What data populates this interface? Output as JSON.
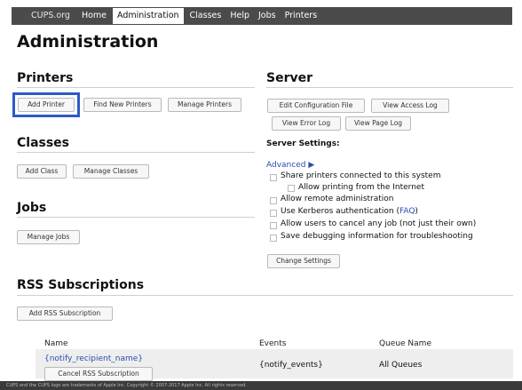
{
  "nav": {
    "items": [
      "CUPS.org",
      "Home",
      "Administration",
      "Classes",
      "Help",
      "Jobs",
      "Printers"
    ],
    "active": "Administration"
  },
  "page_title": "Administration",
  "printers": {
    "heading": "Printers",
    "buttons": [
      "Add Printer",
      "Find New Printers",
      "Manage Printers"
    ]
  },
  "classes": {
    "heading": "Classes",
    "buttons": [
      "Add Class",
      "Manage Classes"
    ]
  },
  "jobs": {
    "heading": "Jobs",
    "buttons": [
      "Manage Jobs"
    ]
  },
  "server": {
    "heading": "Server",
    "buttons": [
      "Edit Configuration File",
      "View Access Log",
      "View Error Log",
      "View Page Log"
    ],
    "settings_title": "Server Settings:",
    "advanced": "Advanced ▶",
    "options": [
      "Share printers connected to this system",
      "Allow printing from the Internet",
      "Allow remote administration",
      "Use Kerberos authentication (",
      "Allow users to cancel any job (not just their own)",
      "Save debugging information for troubleshooting"
    ],
    "faq_label": "FAQ",
    "faq_close": ")",
    "change_button": "Change Settings"
  },
  "rss": {
    "heading": "RSS Subscriptions",
    "add_button": "Add RSS Subscription",
    "columns": [
      "Name",
      "Events",
      "Queue Name"
    ],
    "rows": [
      {
        "name": "{notify_recipient_name}",
        "cancel_button": "Cancel RSS Subscription",
        "events": "{notify_events}",
        "queue": "All Queues"
      }
    ]
  },
  "footer": "CUPS and the CUPS logo are trademarks of Apple Inc. Copyright © 2007-2017 Apple Inc. All rights reserved."
}
